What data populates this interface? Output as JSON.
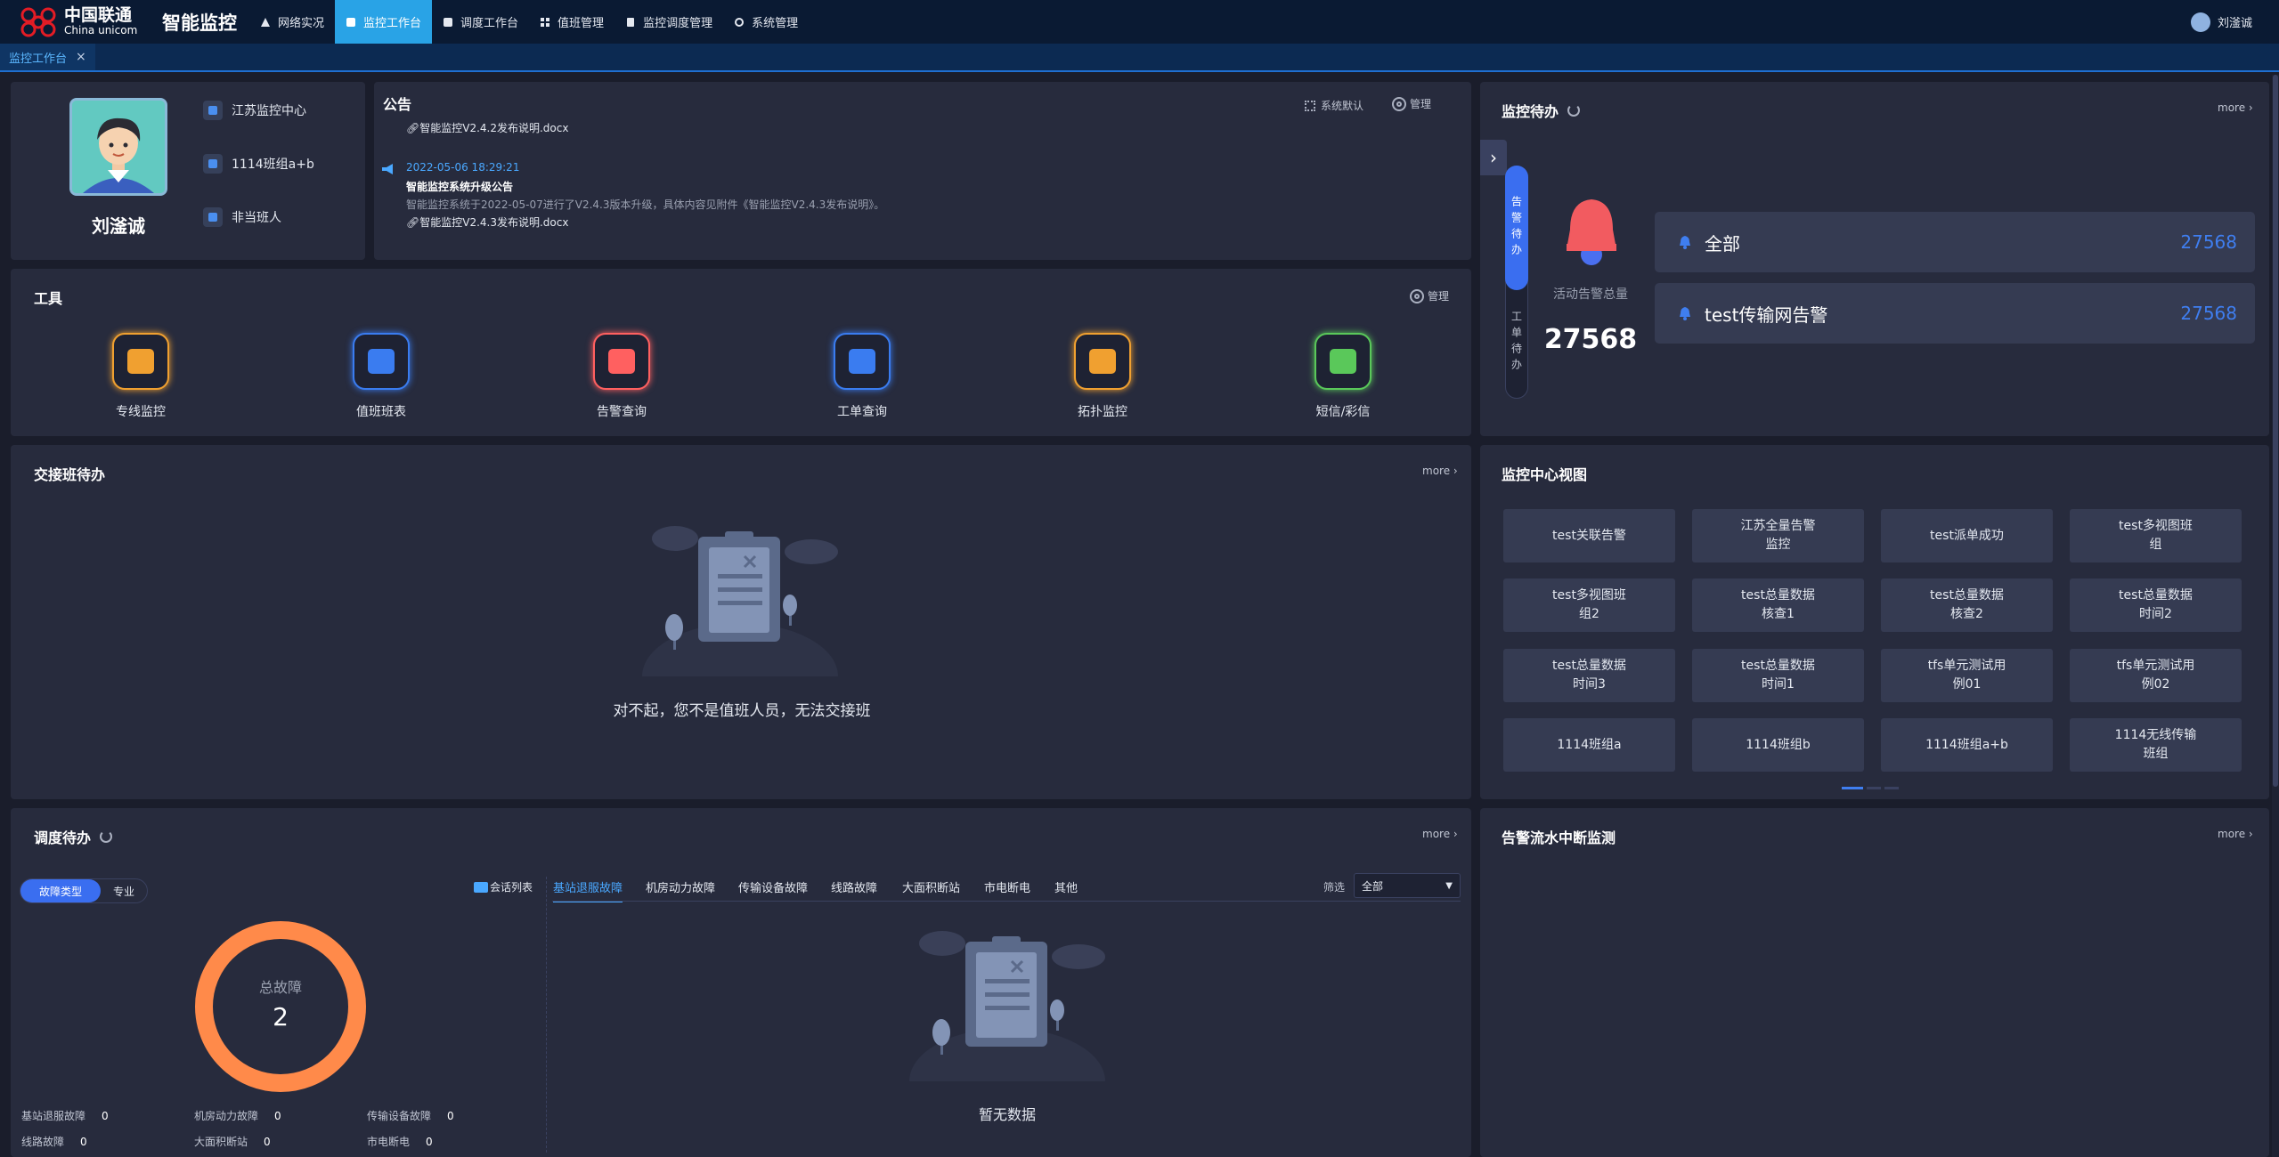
{
  "header": {
    "logo_cn": "中国联通",
    "logo_en": "China unicom",
    "app_name": "智能监控",
    "nav": [
      {
        "label": "网络实况",
        "icon": "triangle-icon"
      },
      {
        "label": "监控工作台",
        "icon": "workbench-icon",
        "active": true
      },
      {
        "label": "调度工作台",
        "icon": "dispatch-icon"
      },
      {
        "label": "值班管理",
        "icon": "grid-icon"
      },
      {
        "label": "监控调度管理",
        "icon": "dispatch-manage-icon"
      },
      {
        "label": "系统管理",
        "icon": "gear-icon"
      }
    ],
    "user_name": "刘滏诚"
  },
  "tabs": [
    {
      "label": "监控工作台",
      "close": "×"
    }
  ],
  "profile": {
    "name": "刘滏诚",
    "center": "江苏监控中心",
    "group": "1114班组a+b",
    "duty_status": "非当班人"
  },
  "notice": {
    "title": "公告",
    "system_default": "系统默认",
    "manage": "管理",
    "attachment1": "智能监控V2.4.2发布说明.docx",
    "date": "2022-05-06 18:29:21",
    "headline": "智能监控系统升级公告",
    "body": "智能监控系统于2022-05-07进行了V2.4.3版本升级，具体内容见附件《智能监控V2.4.3发布说明》。",
    "attachment2": "智能监控V2.4.3发布说明.docx"
  },
  "tools": {
    "title": "工具",
    "manage": "管理",
    "items": [
      {
        "label": "专线监控",
        "color": "#f0a030"
      },
      {
        "label": "值班班表",
        "color": "#3a7cf0"
      },
      {
        "label": "告警查询",
        "color": "#ff6060"
      },
      {
        "label": "工单查询",
        "color": "#3a7cf0"
      },
      {
        "label": "拓扑监控",
        "color": "#f0a030"
      },
      {
        "label": "短信/彩信",
        "color": "#5ac85a"
      }
    ]
  },
  "monitor_todo": {
    "title": "监控待办",
    "more": "more",
    "side_tab_alarm": "告警待办",
    "side_tab_ticket": "工单待办",
    "active_alarm_label": "活动告警总量",
    "active_alarm_total": "27568",
    "rows": [
      {
        "label": "全部",
        "value": "27568"
      },
      {
        "label": "test传输网告警",
        "value": "27568"
      }
    ]
  },
  "handover": {
    "title": "交接班待办",
    "more": "more",
    "empty_text": "对不起，您不是值班人员，无法交接班"
  },
  "center_view": {
    "title": "监控中心视图",
    "items": [
      "test关联告警",
      "江苏全量告警\n监控",
      "test派单成功",
      "test多视图班\n组",
      "test多视图班\n组2",
      "test总量数据\n核查1",
      "test总量数据\n核查2",
      "test总量数据\n时间2",
      "test总量数据\n时间3",
      "test总量数据\n时间1",
      "tfs单元测试用\n例01",
      "tfs单元测试用\n例02",
      "1114班组a",
      "1114班组b",
      "1114班组a+b",
      "1114无线传输\n班组"
    ]
  },
  "dispatch": {
    "title": "调度待办",
    "more": "more",
    "toggle": [
      "故障类型",
      "专业"
    ],
    "session_list": "会话列表",
    "total_label": "总故障",
    "total_value": "2",
    "legend": [
      {
        "label": "基站退服故障",
        "value": "0"
      },
      {
        "label": "机房动力故障",
        "value": "0"
      },
      {
        "label": "传输设备故障",
        "value": "0"
      },
      {
        "label": "线路故障",
        "value": "0"
      },
      {
        "label": "大面积断站",
        "value": "0"
      },
      {
        "label": "市电断电",
        "value": "0"
      }
    ],
    "tabs": [
      "基站退服故障",
      "机房动力故障",
      "传输设备故障",
      "线路故障",
      "大面积断站",
      "市电断电",
      "其他"
    ],
    "filter_label": "筛选",
    "filter_value": "全部",
    "empty_text": "暂无数据",
    "donut_color": "#ff8a4a"
  },
  "alarm_flow": {
    "title": "告警流水中断监测",
    "more": "more"
  }
}
